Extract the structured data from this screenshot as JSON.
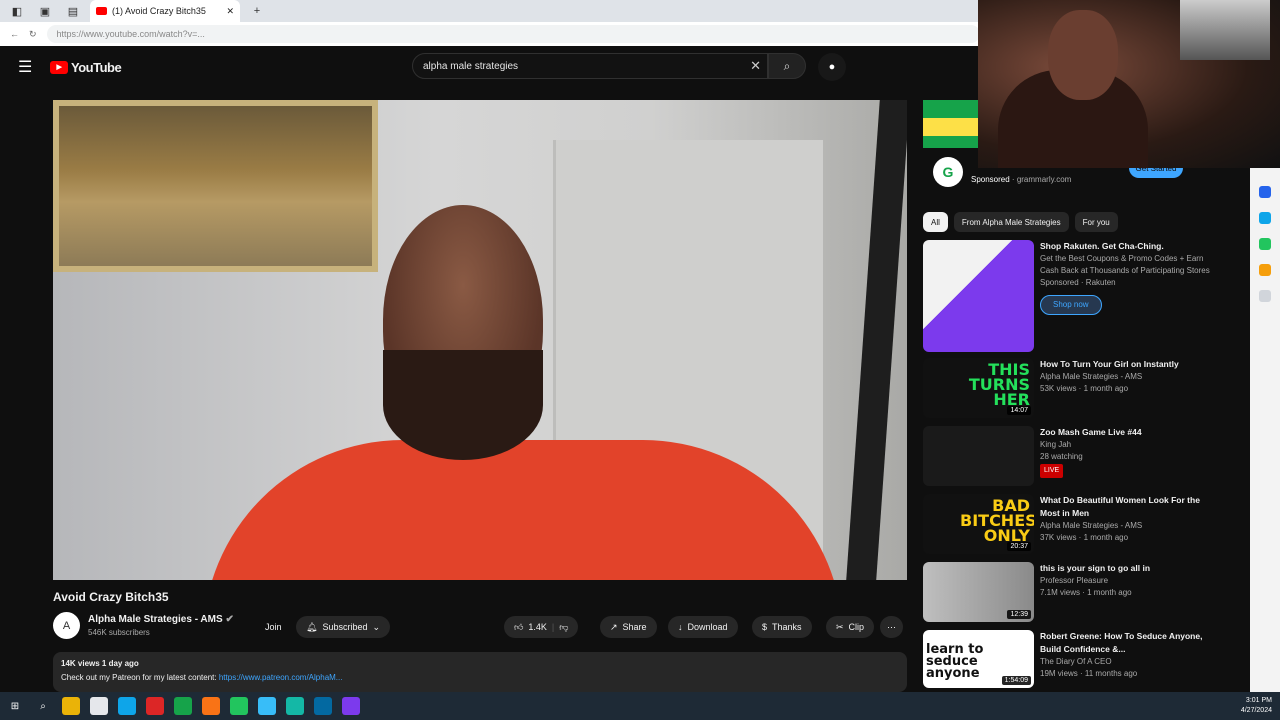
{
  "browser": {
    "tab_title": "(1) Avoid Crazy Bitch35",
    "url": "https://www.youtube.com/watch?v=..."
  },
  "header": {
    "logo_text": "YouTube",
    "search_value": "alpha male strategies"
  },
  "video": {
    "title": "Avoid Crazy Bitch35",
    "channel": "Alpha Male Strategies - AMS",
    "subscribers": "546K subscribers",
    "join": "Join",
    "subscribed": "Subscribed",
    "likes": "1.4K",
    "share": "Share",
    "download": "Download",
    "thanks": "Thanks",
    "clip": "Clip",
    "views_date": "14K views  1 day ago",
    "desc_text": "Check out my Patreon for my latest content:",
    "desc_link": "https://www.patreon.com/AlphaM..."
  },
  "ad": {
    "title": "G",
    "sponsored": "Sponsored",
    "domain": "grammarly.com",
    "cta": "Get Started"
  },
  "chips": [
    "All",
    "From Alpha Male Strategies",
    "For you"
  ],
  "recommendations": [
    {
      "title": "Shop Rakuten. Get Cha-Ching.",
      "meta1": "Get the Best Coupons & Promo Codes + Earn Cash Back at Thousands of Participating Stores",
      "meta2": "Sponsored · Rakuten",
      "cta": "Shop now",
      "thumb_text": ""
    },
    {
      "title": "How To Turn Your Girl on Instantly",
      "meta1": "Alpha Male Strategies - AMS",
      "meta2": "53K views · 1 month ago",
      "duration": "14:07",
      "thumb_text": "THIS TURNS HER"
    },
    {
      "title": "Zoo Mash Game Live #44",
      "meta1": "King Jah",
      "meta2": "28 watching",
      "live": "LIVE",
      "thumb_text": ""
    },
    {
      "title": "What Do Beautiful Women Look For the Most in Men",
      "meta1": "Alpha Male Strategies - AMS",
      "meta2": "37K views · 1 month ago",
      "duration": "20:37",
      "thumb_text": "BAD BITCHES ONLY"
    },
    {
      "title": "this is your sign to go all in",
      "meta1": "Professor Pleasure",
      "meta2": "7.1M views · 1 month ago",
      "duration": "12:39",
      "thumb_text": ""
    },
    {
      "title": "Robert Greene: How To Seduce Anyone, Build Confidence &...",
      "meta1": "The Diary Of A CEO",
      "meta2": "19M views · 11 months ago",
      "duration": "1:54:09",
      "thumb_text": "learn to seduce anyone"
    }
  ],
  "taskbar": {
    "time": "3:01 PM",
    "date": "4/27/2024"
  },
  "colors": {
    "accent": "#3ea6ff",
    "brand": "#ff0000",
    "bg": "#0f0f0f"
  }
}
